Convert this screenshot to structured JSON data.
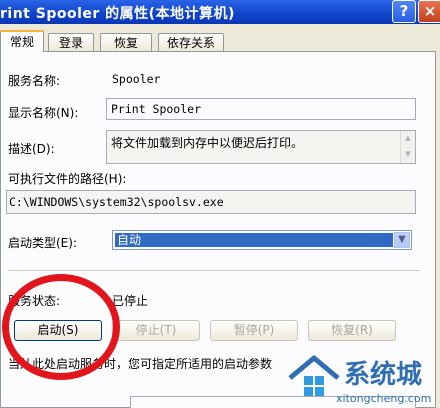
{
  "window": {
    "title": "rint Spooler 的属性(本地计算机)",
    "help_label": "?",
    "close_label": "×"
  },
  "tabs": [
    {
      "label": "常规"
    },
    {
      "label": "登录"
    },
    {
      "label": "恢复"
    },
    {
      "label": "依存关系"
    }
  ],
  "general": {
    "service_name_label": "服务名称:",
    "service_name_value": "Spooler",
    "display_name_label": "显示名称(N):",
    "display_name_value": "Print Spooler",
    "description_label": "描述(D):",
    "description_value": "将文件加载到内存中以便迟后打印。",
    "path_label": "可执行文件的路径(H):",
    "path_value": "C:\\WINDOWS\\system32\\spoolsv.exe",
    "startup_type_label": "启动类型(E):",
    "startup_type_value": "自动",
    "status_label": "服务状态:",
    "status_value": "已停止",
    "hint_text": "当从此处启动服务时，您可指定所适用的启动参数"
  },
  "buttons": {
    "start": "启动(S)",
    "stop": "停止(T)",
    "pause": "暂停(P)",
    "resume": "恢复(R)"
  },
  "watermark": {
    "brand": "系统城",
    "url": "xitongcheng.com"
  },
  "colors": {
    "titlebar": "#1044c8",
    "selection": "#316ac5",
    "annotation": "#e2141c",
    "watermark": "#2f6fb1"
  }
}
